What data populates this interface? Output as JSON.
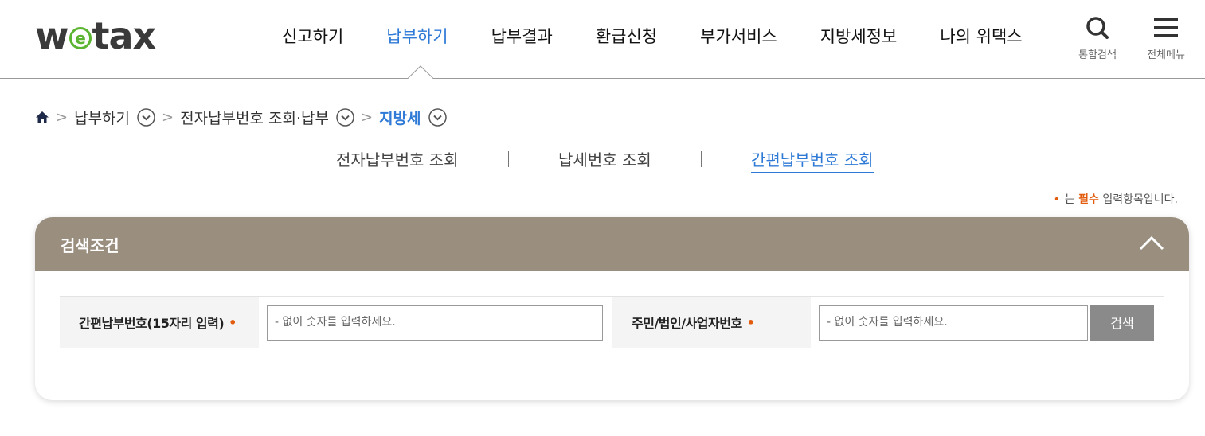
{
  "logo": {
    "before": "w",
    "circle": "e",
    "after": "tax"
  },
  "gnb": [
    {
      "label": "신고하기",
      "active": false
    },
    {
      "label": "납부하기",
      "active": true
    },
    {
      "label": "납부결과",
      "active": false
    },
    {
      "label": "환급신청",
      "active": false
    },
    {
      "label": "부가서비스",
      "active": false
    },
    {
      "label": "지방세정보",
      "active": false
    },
    {
      "label": "나의 위택스",
      "active": false
    }
  ],
  "util": {
    "search_label": "통합검색",
    "search_icon": "search-icon",
    "menu_label": "전체메뉴",
    "menu_icon": "hamburger-icon"
  },
  "breadcrumb": {
    "home_icon": "home-icon",
    "items": [
      "납부하기",
      "전자납부번호 조회·납부",
      "지방세"
    ]
  },
  "tabs": [
    {
      "label": "전자납부번호 조회",
      "active": false
    },
    {
      "label": "납세번호 조회",
      "active": false
    },
    {
      "label": "간편납부번호 조회",
      "active": true
    }
  ],
  "required_note": {
    "dot": "•",
    "prefix": "는 ",
    "must": "필수",
    "suffix": " 입력항목입니다."
  },
  "panel": {
    "title": "검색조건",
    "fields": {
      "label1": "간편납부번호(15자리 입력)",
      "placeholder1": "- 없이 숫자를 입력하세요.",
      "label2": "주민/법인/사업자번호",
      "placeholder2": "- 없이 숫자를 입력하세요.",
      "required_mark": "•"
    },
    "search_button": "검색"
  },
  "colors": {
    "accent": "#2f7ad6",
    "panel_head": "#9a8f7f",
    "required": "#e35b0d",
    "logo_green": "#5cb531"
  }
}
